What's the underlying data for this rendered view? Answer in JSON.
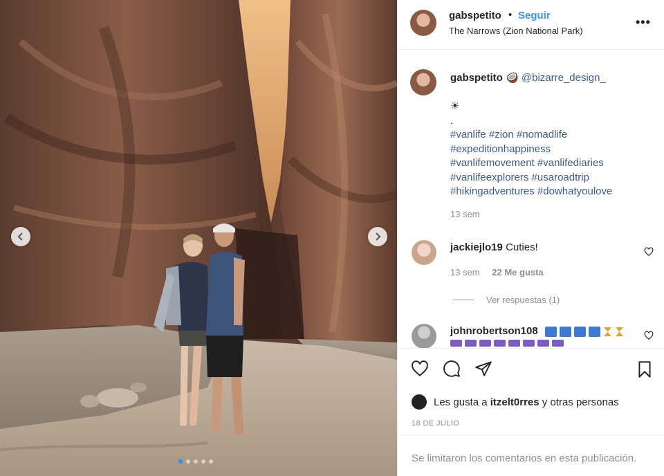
{
  "post": {
    "author": "gabspetito",
    "follow_label": "Seguir",
    "separator": "•",
    "location": "The Narrows (Zion National Park)",
    "more_label": "•••"
  },
  "caption": {
    "author": "gabspetito",
    "emoji": "🥥",
    "mention": "@bizarre_design_",
    "emoji_line": "☀",
    "dot_line": ".",
    "hashtag_lines": [
      "#vanlife #zion #nomadlife",
      "#expeditionhappiness",
      "#vanlifemovement #vanlifediaries",
      "#vanlifeexplorers #usaroadtrip",
      "#hikingadventures #dowhatyoulove"
    ],
    "time": "13 sem"
  },
  "comments": [
    {
      "user": "jackiejlo19",
      "text": "Cuties!",
      "time": "13 sem",
      "likes": "22 Me gusta",
      "replies": "Ver respuestas (1)"
    },
    {
      "user": "johnrobertson108",
      "text": ""
    }
  ],
  "likes": {
    "prefix": "Les gusta a",
    "user": "itzelt0rres",
    "suffix": "y otras personas"
  },
  "date": "18 DE JULIO",
  "footer": "Se limitaron los comentarios en esta publicación.",
  "carousel": {
    "count": 5,
    "active_index": 0
  },
  "icons": {
    "like": "heart-icon",
    "comment": "comment-icon",
    "share": "share-icon",
    "save": "bookmark-icon"
  }
}
